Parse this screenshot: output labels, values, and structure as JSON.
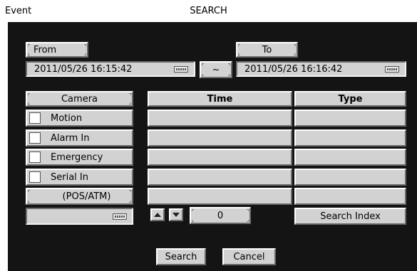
{
  "window": {
    "left_title": "Event",
    "center_title": "SEARCH"
  },
  "from": {
    "label": "From",
    "value": "2011/05/26  16:15:42",
    "icon": "keyboard-icon"
  },
  "to": {
    "label": "To",
    "value": "2011/05/26  16:16:42",
    "icon": "keyboard-icon"
  },
  "range_separator": "~",
  "filters": {
    "camera_label": "Camera",
    "items": [
      {
        "label": "Motion",
        "checked": false
      },
      {
        "label": "Alarm In",
        "checked": false
      },
      {
        "label": "Emergency",
        "checked": false
      },
      {
        "label": "Serial In",
        "checked": false
      }
    ],
    "pos_label": "(POS/ATM)",
    "keyword_value": ""
  },
  "results": {
    "headers": {
      "time": "Time",
      "type": "Type"
    },
    "rows": [
      {
        "time": "",
        "type": ""
      },
      {
        "time": "",
        "type": ""
      },
      {
        "time": "",
        "type": ""
      },
      {
        "time": "",
        "type": ""
      },
      {
        "time": "",
        "type": ""
      }
    ]
  },
  "paging": {
    "page": "0"
  },
  "buttons": {
    "search_index": "Search Index",
    "search": "Search",
    "cancel": "Cancel"
  }
}
